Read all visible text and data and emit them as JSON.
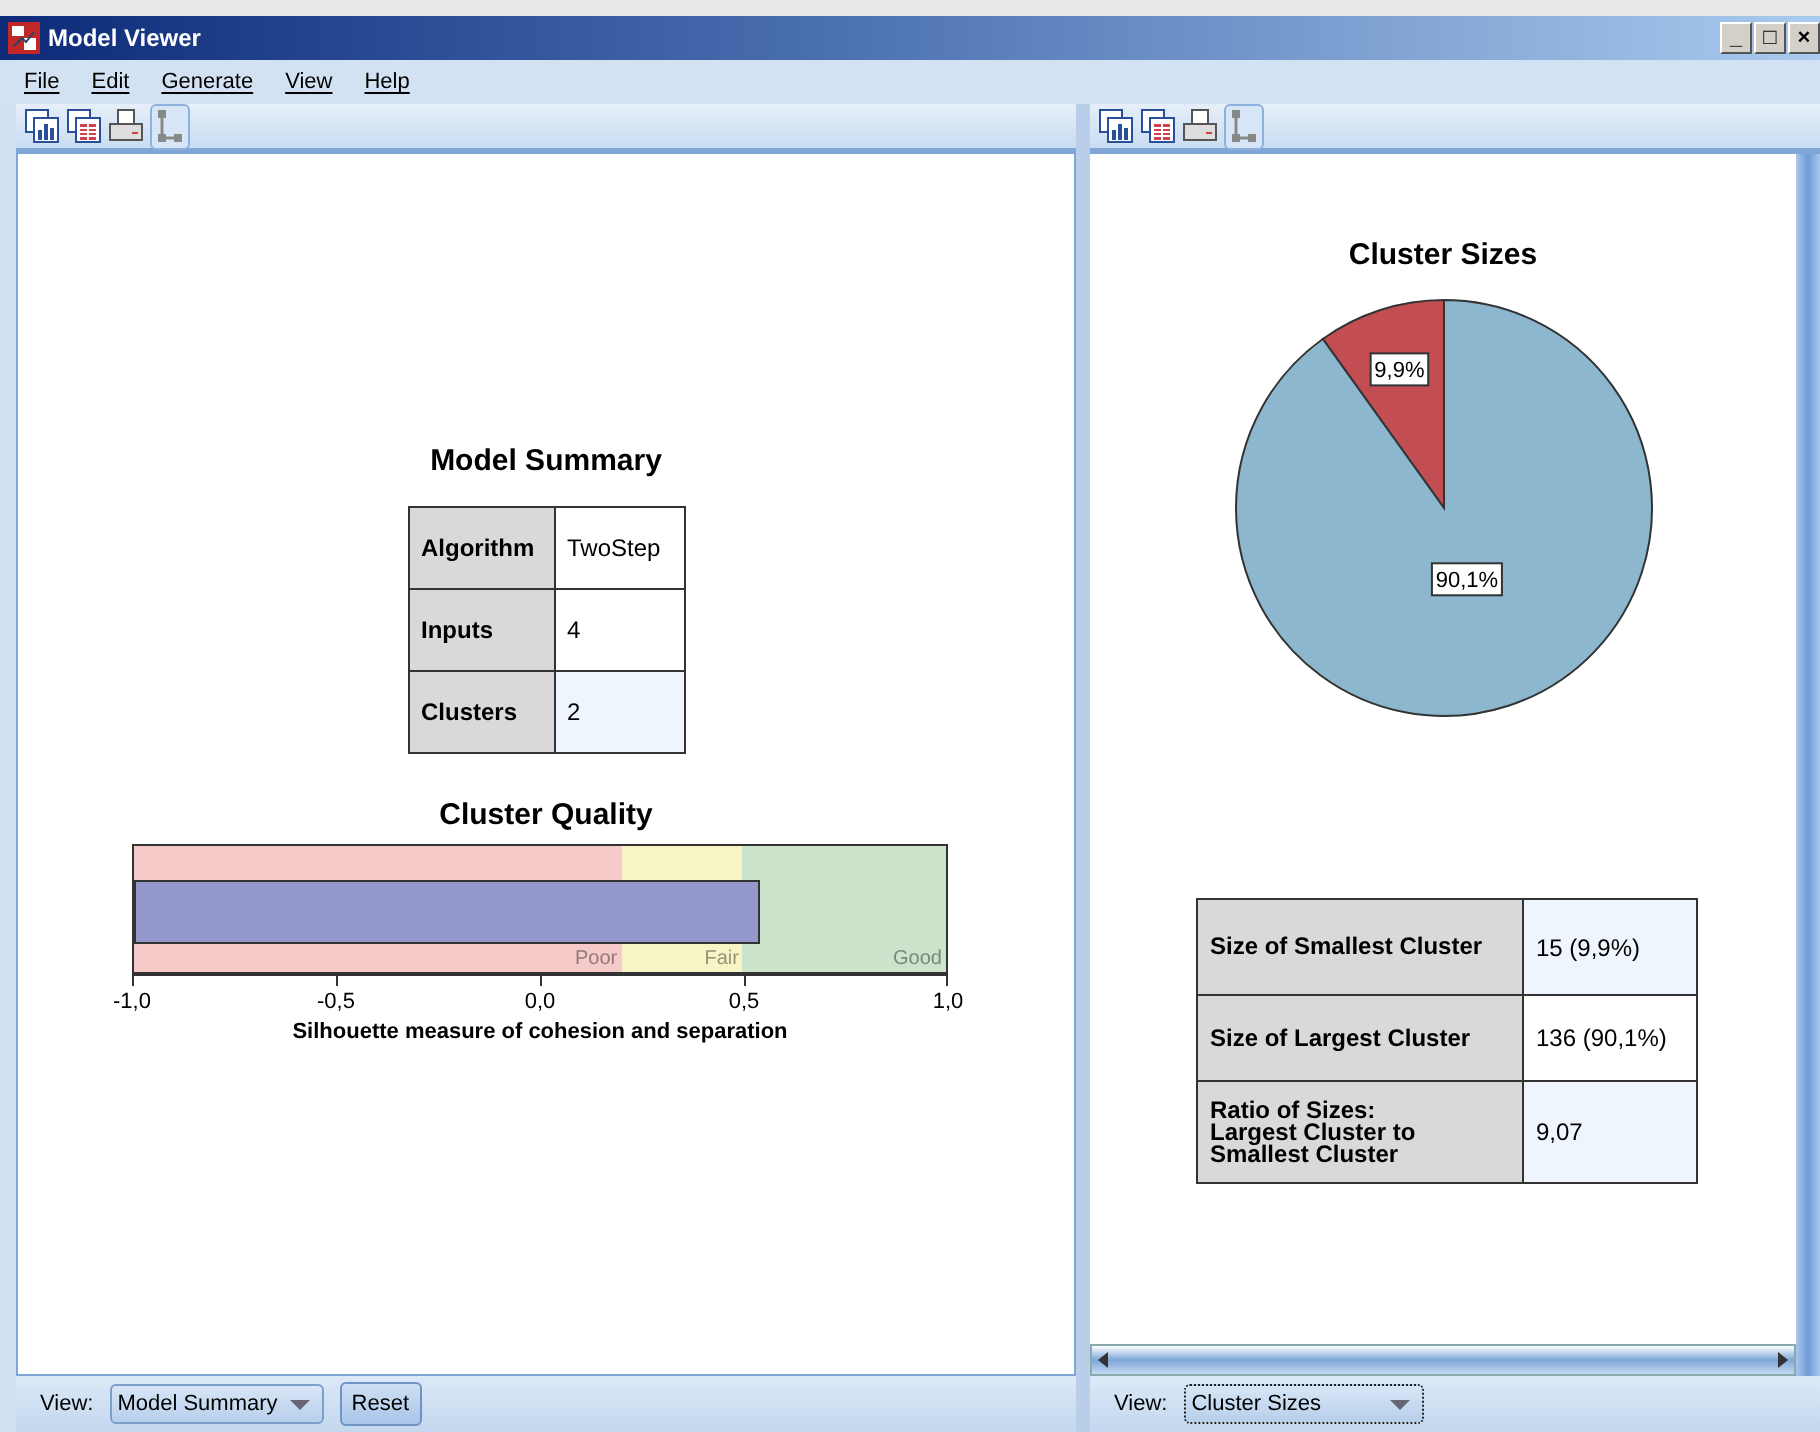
{
  "window": {
    "title": "Model Viewer",
    "controls": [
      "_",
      "□",
      "×"
    ]
  },
  "menu": [
    "File",
    "Edit",
    "Generate",
    "View",
    "Help"
  ],
  "left_pane": {
    "summary_title": "Model Summary",
    "summary": [
      {
        "label": "Algorithm",
        "value": "TwoStep"
      },
      {
        "label": "Inputs",
        "value": "4"
      },
      {
        "label": "Clusters",
        "value": "2"
      }
    ],
    "quality": {
      "title": "Cluster Quality",
      "level": 0.77,
      "bands": [
        {
          "label": "Poor",
          "color": "#f7caca"
        },
        {
          "label": "Fair",
          "color": "#f7f5c6"
        },
        {
          "label": "Good",
          "color": "#cce3cc"
        }
      ],
      "ticks": [
        "-1,0",
        "-0,5",
        "0,0",
        "0,5",
        "1,0"
      ],
      "axis_title": "Silhouette measure of cohesion and separation"
    },
    "footer": {
      "view_label": "View:",
      "view_value": "Model Summary",
      "button": "Reset"
    }
  },
  "right_pane": {
    "pie": {
      "chart_data": {
        "type": "pie",
        "title": "Cluster Sizes",
        "values": [
          9.9,
          90.1
        ],
        "colors": [
          "#c24d52",
          "#8cb7cf"
        ],
        "value_labels": [
          "9,9%",
          "90,1%"
        ]
      }
    },
    "sizes": [
      {
        "label": "Size of Smallest Cluster",
        "value": "15 (9,9%)"
      },
      {
        "label": "Size of Largest Cluster",
        "value": "136 (90,1%)"
      },
      {
        "label": "Ratio of Sizes:\nLargest Cluster to\nSmallest Cluster",
        "value": "9,07"
      }
    ],
    "footer": {
      "view_label": "View:",
      "view_value": "Cluster Sizes"
    }
  }
}
